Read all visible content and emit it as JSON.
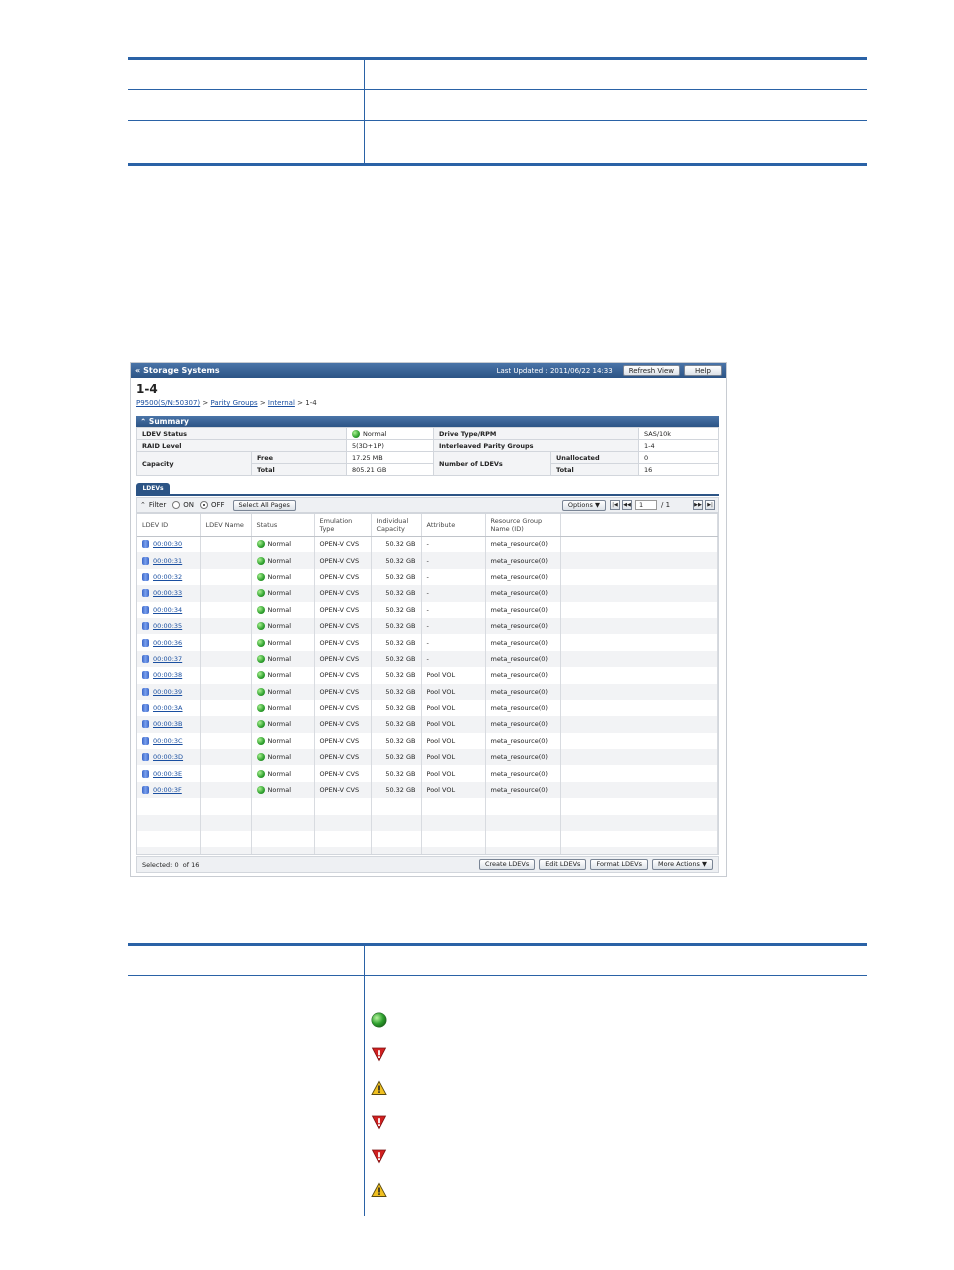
{
  "window": {
    "title": "Storage Systems",
    "last_updated": "Last Updated : 2011/06/22 14:33",
    "refresh_label": "Refresh View",
    "help_label": "Help"
  },
  "page": {
    "title": "1-4",
    "breadcrumb": [
      "P9500(S/N:50307)",
      "Parity Groups",
      "Internal",
      "1-4"
    ]
  },
  "summary": {
    "heading": "Summary",
    "ldev_status_label": "LDEV Status",
    "ldev_status_value": "Normal",
    "raid_level_label": "RAID Level",
    "raid_level_value": "5(3D+1P)",
    "capacity_label": "Capacity",
    "free_label": "Free",
    "free_value": "17.25 MB",
    "total_label": "Total",
    "total_value": "805.21 GB",
    "drive_label": "Drive Type/RPM",
    "drive_value": "SAS/10k",
    "interleaved_label": "Interleaved Parity Groups",
    "interleaved_value": "1-4",
    "num_ldevs_label": "Number of LDEVs",
    "unallocated_label": "Unallocated",
    "unallocated_value": "0",
    "ldev_total_label": "Total",
    "ldev_total_value": "16"
  },
  "tabs": {
    "ldevs": "LDEVs"
  },
  "toolbar": {
    "filter": "Filter",
    "on": "ON",
    "off": "OFF",
    "select_all": "Select All Pages",
    "options": "Options",
    "page_value": "1",
    "page_total": "/ 1"
  },
  "columns": {
    "ldev_id": "LDEV ID",
    "ldev_name": "LDEV Name",
    "status": "Status",
    "emulation": "Emulation Type",
    "capacity": "Individual Capacity",
    "attribute": "Attribute",
    "resource": "Resource Group Name (ID)"
  },
  "rows": [
    {
      "id": "00:00:30",
      "status": "Normal",
      "emu": "OPEN-V CVS",
      "cap": "50.32 GB",
      "attr": "-",
      "res": "meta_resource(0)"
    },
    {
      "id": "00:00:31",
      "status": "Normal",
      "emu": "OPEN-V CVS",
      "cap": "50.32 GB",
      "attr": "-",
      "res": "meta_resource(0)"
    },
    {
      "id": "00:00:32",
      "status": "Normal",
      "emu": "OPEN-V CVS",
      "cap": "50.32 GB",
      "attr": "-",
      "res": "meta_resource(0)"
    },
    {
      "id": "00:00:33",
      "status": "Normal",
      "emu": "OPEN-V CVS",
      "cap": "50.32 GB",
      "attr": "-",
      "res": "meta_resource(0)"
    },
    {
      "id": "00:00:34",
      "status": "Normal",
      "emu": "OPEN-V CVS",
      "cap": "50.32 GB",
      "attr": "-",
      "res": "meta_resource(0)"
    },
    {
      "id": "00:00:35",
      "status": "Normal",
      "emu": "OPEN-V CVS",
      "cap": "50.32 GB",
      "attr": "-",
      "res": "meta_resource(0)"
    },
    {
      "id": "00:00:36",
      "status": "Normal",
      "emu": "OPEN-V CVS",
      "cap": "50.32 GB",
      "attr": "-",
      "res": "meta_resource(0)"
    },
    {
      "id": "00:00:37",
      "status": "Normal",
      "emu": "OPEN-V CVS",
      "cap": "50.32 GB",
      "attr": "-",
      "res": "meta_resource(0)"
    },
    {
      "id": "00:00:38",
      "status": "Normal",
      "emu": "OPEN-V CVS",
      "cap": "50.32 GB",
      "attr": "Pool VOL",
      "res": "meta_resource(0)"
    },
    {
      "id": "00:00:39",
      "status": "Normal",
      "emu": "OPEN-V CVS",
      "cap": "50.32 GB",
      "attr": "Pool VOL",
      "res": "meta_resource(0)"
    },
    {
      "id": "00:00:3A",
      "status": "Normal",
      "emu": "OPEN-V CVS",
      "cap": "50.32 GB",
      "attr": "Pool VOL",
      "res": "meta_resource(0)"
    },
    {
      "id": "00:00:3B",
      "status": "Normal",
      "emu": "OPEN-V CVS",
      "cap": "50.32 GB",
      "attr": "Pool VOL",
      "res": "meta_resource(0)"
    },
    {
      "id": "00:00:3C",
      "status": "Normal",
      "emu": "OPEN-V CVS",
      "cap": "50.32 GB",
      "attr": "Pool VOL",
      "res": "meta_resource(0)"
    },
    {
      "id": "00:00:3D",
      "status": "Normal",
      "emu": "OPEN-V CVS",
      "cap": "50.32 GB",
      "attr": "Pool VOL",
      "res": "meta_resource(0)"
    },
    {
      "id": "00:00:3E",
      "status": "Normal",
      "emu": "OPEN-V CVS",
      "cap": "50.32 GB",
      "attr": "Pool VOL",
      "res": "meta_resource(0)"
    },
    {
      "id": "00:00:3F",
      "status": "Normal",
      "emu": "OPEN-V CVS",
      "cap": "50.32 GB",
      "attr": "Pool VOL",
      "res": "meta_resource(0)"
    }
  ],
  "empty_rows": 4,
  "footer": {
    "selected": "Selected:",
    "selected_count": "0",
    "of": "of",
    "total": "16",
    "create": "Create LDEVs",
    "edit": "Edit LDEVs",
    "format": "Format LDEVs",
    "more": "More Actions"
  },
  "status_icons": [
    "normal-icon",
    "error-icon",
    "warning-icon",
    "error-icon",
    "error-icon",
    "warning-icon"
  ],
  "colors": {
    "rule": "#2a62a6",
    "titlebar": "#2c5485",
    "link": "#1a4fa0",
    "ok": "#2ea02e",
    "error": "#d02020",
    "warning": "#f0c020"
  }
}
